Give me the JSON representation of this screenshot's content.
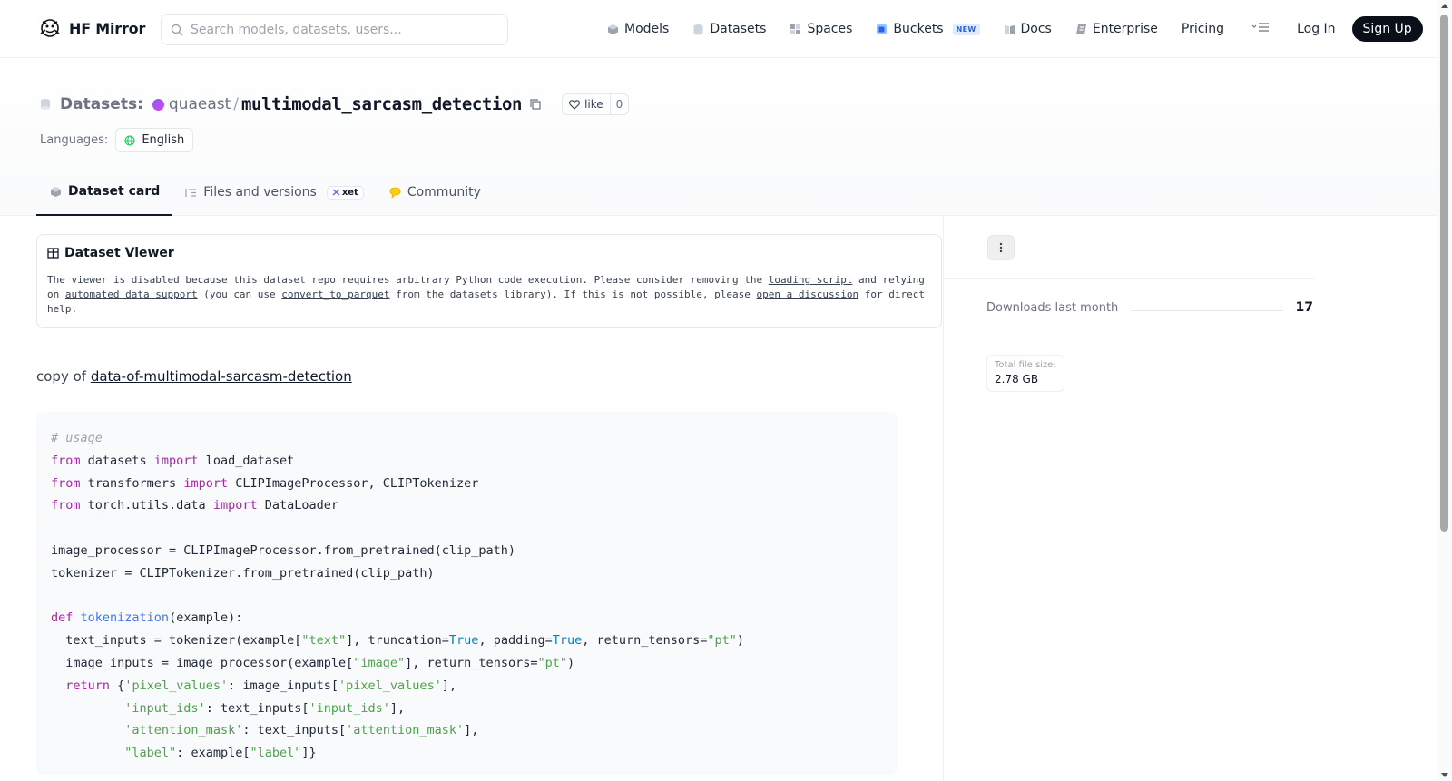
{
  "header": {
    "brand": "HF Mirror",
    "search_placeholder": "Search models, datasets, users...",
    "nav": [
      {
        "label": "Models",
        "icon": "cube-icon"
      },
      {
        "label": "Datasets",
        "icon": "database-icon"
      },
      {
        "label": "Spaces",
        "icon": "grid-icon"
      },
      {
        "label": "Buckets",
        "icon": "bucket-icon",
        "badge": "NEW"
      },
      {
        "label": "Docs",
        "icon": "book-icon"
      },
      {
        "label": "Enterprise",
        "icon": "enterprise-icon"
      },
      {
        "label": "Pricing"
      }
    ],
    "login": "Log In",
    "signup": "Sign Up"
  },
  "repo": {
    "type_label": "Datasets:",
    "owner": "quaeast",
    "slash": "/",
    "name": "multimodal_sarcasm_detection",
    "like_label": "like",
    "like_count": "0",
    "languages_label": "Languages:",
    "language": "English"
  },
  "tabs": [
    {
      "label": "Dataset card",
      "active": true
    },
    {
      "label": "Files and versions",
      "chip": "xet"
    },
    {
      "label": "Community"
    }
  ],
  "viewer": {
    "title": "Dataset Viewer",
    "text_1": "The viewer is disabled because this dataset repo requires arbitrary Python code execution. Please consider removing the ",
    "link_1": "loading script",
    "text_2": " and relying on ",
    "link_2": "automated data support",
    "text_3": " (you can use ",
    "link_3": "convert_to_parquet",
    "text_4": " from the datasets library). If this is not possible, please ",
    "link_4": "open a discussion",
    "text_5": " for direct help."
  },
  "card": {
    "copy_prefix": "copy of ",
    "copy_link": "data-of-multimodal-sarcasm-detection"
  },
  "code_lines": [
    [
      [
        "cm",
        "# usage"
      ]
    ],
    [
      [
        "kw",
        "from"
      ],
      [
        "",
        " datasets "
      ],
      [
        "kw",
        "import"
      ],
      [
        "",
        " load_dataset"
      ]
    ],
    [
      [
        "kw",
        "from"
      ],
      [
        "",
        " transformers "
      ],
      [
        "kw",
        "import"
      ],
      [
        "",
        " CLIPImageProcessor, CLIPTokenizer"
      ]
    ],
    [
      [
        "kw",
        "from"
      ],
      [
        "",
        " torch.utils.data "
      ],
      [
        "kw",
        "import"
      ],
      [
        "",
        " DataLoader"
      ]
    ],
    [
      [
        "",
        ""
      ]
    ],
    [
      [
        "",
        "image_processor = CLIPImageProcessor.from_pretrained(clip_path)"
      ]
    ],
    [
      [
        "",
        "tokenizer = CLIPTokenizer.from_pretrained(clip_path)"
      ]
    ],
    [
      [
        "",
        ""
      ]
    ],
    [
      [
        "kw",
        "def"
      ],
      [
        "",
        " "
      ],
      [
        "fn",
        "tokenization"
      ],
      [
        "",
        "(example):"
      ]
    ],
    [
      [
        "",
        "  text_inputs = tokenizer(example["
      ],
      [
        "st",
        "\"text\""
      ],
      [
        "",
        "], truncation="
      ],
      [
        "bl",
        "True"
      ],
      [
        "",
        ", padding="
      ],
      [
        "bl",
        "True"
      ],
      [
        "",
        ", return_tensors="
      ],
      [
        "st",
        "\"pt\""
      ],
      [
        "",
        ")"
      ]
    ],
    [
      [
        "",
        "  image_inputs = image_processor(example["
      ],
      [
        "st",
        "\"image\""
      ],
      [
        "",
        "], return_tensors="
      ],
      [
        "st",
        "\"pt\""
      ],
      [
        "",
        ")"
      ]
    ],
    [
      [
        "",
        "  "
      ],
      [
        "kw",
        "return"
      ],
      [
        "",
        " {"
      ],
      [
        "st",
        "'pixel_values'"
      ],
      [
        "",
        ": image_inputs["
      ],
      [
        "st",
        "'pixel_values'"
      ],
      [
        "",
        "],"
      ]
    ],
    [
      [
        "",
        "          "
      ],
      [
        "st",
        "'input_ids'"
      ],
      [
        "",
        ": text_inputs["
      ],
      [
        "st",
        "'input_ids'"
      ],
      [
        "",
        "],"
      ]
    ],
    [
      [
        "",
        "          "
      ],
      [
        "st",
        "'attention_mask'"
      ],
      [
        "",
        ": text_inputs["
      ],
      [
        "st",
        "'attention_mask'"
      ],
      [
        "",
        "],"
      ]
    ],
    [
      [
        "",
        "          "
      ],
      [
        "st",
        "\"label\""
      ],
      [
        "",
        ": example["
      ],
      [
        "st",
        "\"label\""
      ],
      [
        "",
        "]}"
      ]
    ]
  ],
  "sidebar": {
    "downloads_label": "Downloads last month",
    "downloads_value": "17",
    "size_label": "Total file size:",
    "size_value": "2.78 GB"
  },
  "colors": {
    "signup_bg": "#0b0f19",
    "new_badge": "#2563eb",
    "keyword": "#a626a4",
    "string": "#50a14f",
    "function": "#4078f2",
    "builtin": "#0184bc"
  }
}
